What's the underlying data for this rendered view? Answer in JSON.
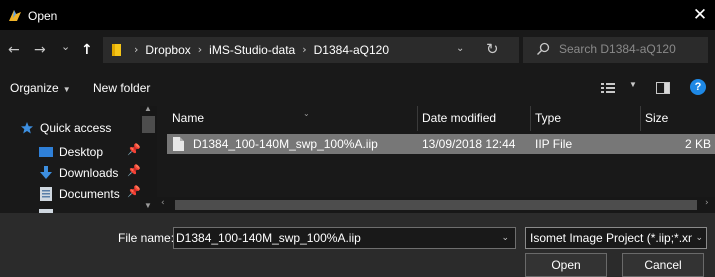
{
  "window": {
    "title": "Open",
    "close_glyph": "✕"
  },
  "nav": {
    "back_glyph": "←",
    "forward_glyph": "→",
    "history_glyph": "⌄",
    "up_glyph": "↑",
    "breadcrumbs": [
      "Dropbox",
      "iMS-Studio-data",
      "D1384-aQ120"
    ],
    "separator": "›",
    "dropdown_glyph": "⌄",
    "refresh_glyph": "↻",
    "search_placeholder": "Search D1384-aQ120"
  },
  "toolbar": {
    "organize_label": "Organize",
    "organize_caret": "▼",
    "new_folder_label": "New folder",
    "view_caret": "▼",
    "help_label": "?"
  },
  "sidebar": {
    "items": [
      {
        "label": "Quick access",
        "icon": "star-icon",
        "pinned": false
      },
      {
        "label": "Desktop",
        "icon": "desktop-icon",
        "pinned": true
      },
      {
        "label": "Downloads",
        "icon": "download-icon",
        "pinned": true
      },
      {
        "label": "Documents",
        "icon": "documents-icon",
        "pinned": true
      }
    ],
    "pin_glyph": "📌"
  },
  "files": {
    "columns": [
      "Name",
      "Date modified",
      "Type",
      "Size"
    ],
    "rows": [
      {
        "name": "D1384_100-140M_swp_100%A.iip",
        "date": "13/09/2018 12:44",
        "type": "IIP File",
        "size": "2 KB"
      }
    ]
  },
  "footer": {
    "file_name_label": "File name:",
    "file_name_value": "D1384_100-140M_swp_100%A.iip",
    "file_type_value": "Isomet Image Project (*.iip;*.xm",
    "open_label": "Open",
    "cancel_label": "Cancel"
  },
  "colors": {
    "background": "#191919",
    "titlebar": "#000000",
    "selection": "#777777",
    "footer": "#2b2b2b",
    "accent_blue": "#1e88e5",
    "folder_yellow": "#f5c518"
  }
}
